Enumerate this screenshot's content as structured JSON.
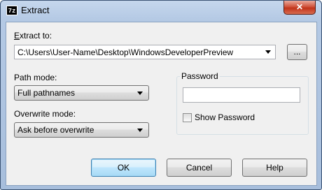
{
  "window": {
    "title": "Extract",
    "app_icon": "7z",
    "close_glyph": "✕"
  },
  "extract_to": {
    "label_access_key": "E",
    "label_rest": "xtract to:",
    "path": "C:\\Users\\User-Name\\Desktop\\WindowsDeveloperPreview",
    "browse_label": "..."
  },
  "path_mode": {
    "label": "Path mode:",
    "selected": "Full pathnames"
  },
  "overwrite_mode": {
    "label": "Overwrite mode:",
    "selected": "Ask before overwrite"
  },
  "password": {
    "group_label": "Password",
    "value": "",
    "show_label": "Show Password",
    "show_checked": false
  },
  "buttons": {
    "ok": "OK",
    "cancel": "Cancel",
    "help": "Help"
  },
  "icons": {
    "dropdown": "chevron-down-icon",
    "close": "close-icon"
  }
}
